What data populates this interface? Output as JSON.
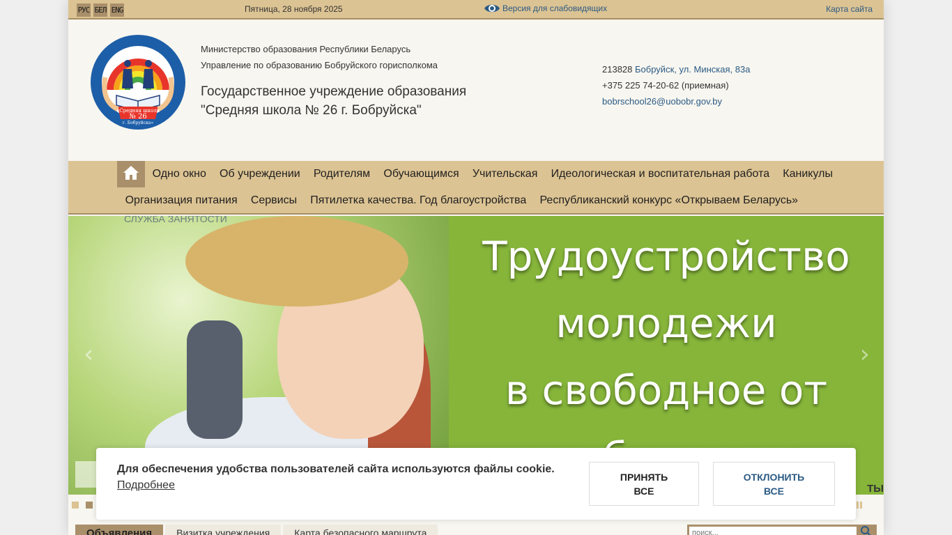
{
  "topbar": {
    "languages": [
      "РУС",
      "БЕЛ",
      "ENG"
    ],
    "date": "Пятница, 28 ноября 2025",
    "vision_label": "Версия для слабовидящих",
    "sitemap_label": "Карта сайта"
  },
  "header": {
    "ministry_line1": "Министерство образования Республики Беларусь",
    "ministry_line2": "Управление по образованию Бобруйского горисполкома",
    "school_line1": "Государственное учреждение образования",
    "school_line2": "\"Средняя школа № 26 г. Бобруйска\"",
    "postal_code": "213828",
    "address": "Бобруйск, ул. Минская, 83а",
    "phone": "+375 225 74-20-62 (приемная)",
    "email": "bobrschool26@uobobr.gov.by",
    "logo_text_top": "ГОСУДАРСТВЕННОЕ УЧРЕЖДЕНИЕ ОБРАЗОВАНИЯ",
    "logo_text_ribbon": "«Средняя школа",
    "logo_text_number": "№ 26",
    "logo_text_city": "г. Бобруйска»"
  },
  "nav": {
    "row1": [
      "Одно окно",
      "Об учреждении",
      "Родителям",
      "Обучающимся",
      "Учительская",
      "Идеологическая и воспитательная работа",
      "Каникулы"
    ],
    "row2": [
      "Организация питания",
      "Сервисы",
      "Пятилетка качества. Год благоустройства",
      "Республиканский конкурс «Открываем Беларусь»"
    ]
  },
  "slider": {
    "banner_line1": "Трудоустройство",
    "banner_line2": "молодежи",
    "banner_line3": "в свободное от",
    "banner_line4": "учебы время",
    "top_label": "СЛУЖБА ЗАНЯТОСТИ",
    "caption_tail": "ТЫ",
    "active_slide": 2,
    "slide_count": 2
  },
  "tabs": [
    "Объявления",
    "Визитка учреждения",
    "Карта безопасного маршрута"
  ],
  "search": {
    "placeholder": "поиск..."
  },
  "cookie": {
    "message": "Для обеспечения удобства пользователей сайта используются файлы cookie.",
    "more_label": "Подробнее",
    "accept_line1": "ПРИНЯТЬ",
    "accept_line2": "ВСЕ",
    "reject_line1": "ОТКЛОНИТЬ",
    "reject_line2": "ВСЕ"
  },
  "colors": {
    "page_bg": "#efefef",
    "header_bg": "#f7f6f0",
    "bar_bg": "#dcc393",
    "bar_accent": "#a98f6a",
    "link": "#2b5a84",
    "banner_green": "#86b53a"
  }
}
